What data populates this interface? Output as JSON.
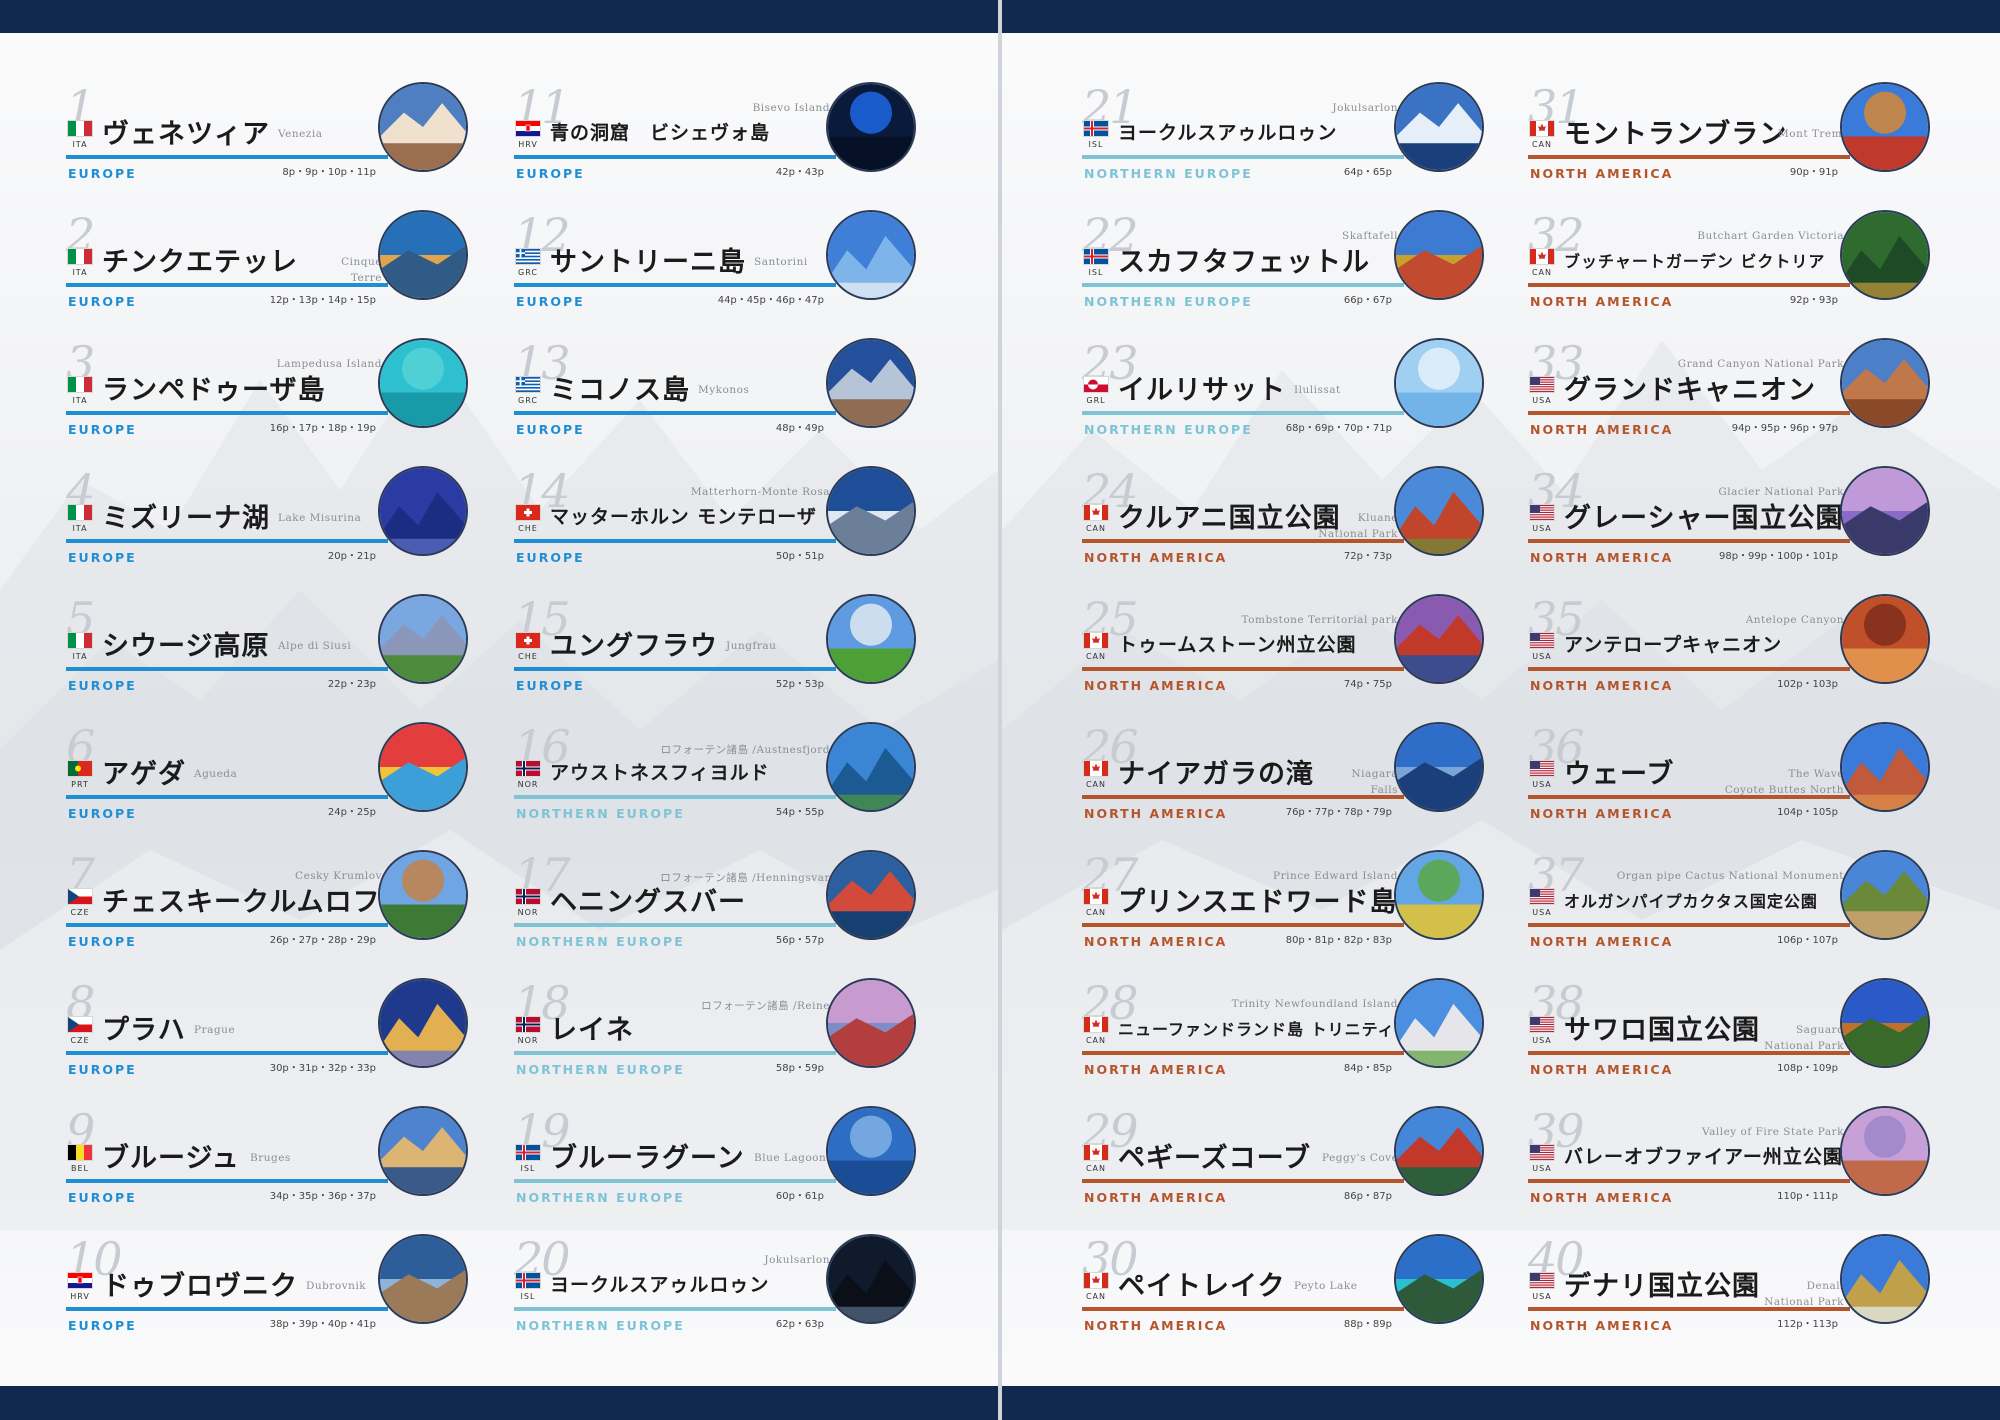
{
  "regions": {
    "europe": {
      "label": "EUROPE",
      "color": "#1f8fd1"
    },
    "northern_europe": {
      "label": "NORTHERN EUROPE",
      "color": "#7ec4d6"
    },
    "north_america": {
      "label": "NORTH AMERICA",
      "color": "#b4552c"
    }
  },
  "entries": [
    {
      "num": "1",
      "code": "ITA",
      "flag": "ita",
      "jp": "ヴェネツィア",
      "en": "Venezia",
      "pages": "8p・9p・10p・11p",
      "region": "EUROPE",
      "rkey": "europe",
      "photo": "venice-photo",
      "colors": [
        "#4f7fc1",
        "#f0e1cf",
        "#9a6e4e"
      ]
    },
    {
      "num": "2",
      "code": "ITA",
      "flag": "ita",
      "jp": "チンクエテッレ",
      "en": "Cinque\nTerre",
      "pages": "12p・13p・14p・15p",
      "region": "EUROPE",
      "rkey": "europe",
      "photo": "cinque-terre-photo",
      "colors": [
        "#2670b8",
        "#e2a34d",
        "#2f5b86"
      ]
    },
    {
      "num": "3",
      "code": "ITA",
      "flag": "ita",
      "jp": "ランペドゥーザ島",
      "en": "Lampedusa Island",
      "pages": "16p・17p・18p・19p",
      "region": "EUROPE",
      "rkey": "europe",
      "photo": "lampedusa-photo",
      "colors": [
        "#2fc0cf",
        "#58d3d5",
        "#199aa8"
      ]
    },
    {
      "num": "4",
      "code": "ITA",
      "flag": "ita",
      "jp": "ミズリーナ湖",
      "en": "Lake Misurina",
      "pages": "20p・21p",
      "region": "EUROPE",
      "rkey": "europe",
      "photo": "misurina-photo",
      "colors": [
        "#2b3ba4",
        "#6071c8",
        "#1b2d83"
      ]
    },
    {
      "num": "5",
      "code": "ITA",
      "flag": "ita",
      "jp": "シウージ高原",
      "en": "Alpe di Siusi",
      "pages": "22p・23p",
      "region": "EUROPE",
      "rkey": "europe",
      "photo": "alpe-di-siusi-photo",
      "colors": [
        "#7aa7e0",
        "#8a97b8",
        "#4d8b3c"
      ]
    },
    {
      "num": "6",
      "code": "PRT",
      "flag": "prt",
      "jp": "アゲダ",
      "en": "Agueda",
      "pages": "24p・25p",
      "region": "EUROPE",
      "rkey": "europe",
      "photo": "agueda-photo",
      "colors": [
        "#e43d3d",
        "#f2c23a",
        "#3c9fd8"
      ]
    },
    {
      "num": "7",
      "code": "CZE",
      "flag": "cze",
      "jp": "チェスキークルムロフ",
      "en": "Cesky Krumlov",
      "pages": "26p・27p・28p・29p",
      "region": "EUROPE",
      "rkey": "europe",
      "photo": "cesky-krumlov-photo",
      "colors": [
        "#6fa5e2",
        "#c9813e",
        "#3d7a35"
      ]
    },
    {
      "num": "8",
      "code": "CZE",
      "flag": "cze",
      "jp": "プラハ",
      "en": "Prague",
      "pages": "30p・31p・32p・33p",
      "region": "EUROPE",
      "rkey": "europe",
      "photo": "prague-photo",
      "colors": [
        "#1f3a8c",
        "#5c6fd6",
        "#e2b050"
      ]
    },
    {
      "num": "9",
      "code": "BEL",
      "flag": "bel",
      "jp": "ブルージュ",
      "en": "Bruges",
      "pages": "34p・35p・36p・37p",
      "region": "EUROPE",
      "rkey": "europe",
      "photo": "bruges-photo",
      "colors": [
        "#4d83cf",
        "#dcb474",
        "#3a5a8a"
      ]
    },
    {
      "num": "10",
      "code": "HRV",
      "flag": "hrv",
      "jp": "ドゥブロヴニク",
      "en": "Dubrovnik",
      "pages": "38p・39p・40p・41p",
      "region": "EUROPE",
      "rkey": "europe",
      "photo": "dubrovnik-photo",
      "colors": [
        "#2d5e9a",
        "#8fb2d6",
        "#9a7a58"
      ]
    },
    {
      "num": "11",
      "code": "HRV",
      "flag": "hrv",
      "jp": "青の洞窟　ビシェヴォ島",
      "en": "Bisevo Island",
      "pages": "42p・43p",
      "region": "EUROPE",
      "rkey": "europe",
      "photo": "bisevo-photo",
      "colors": [
        "#0a1a3a",
        "#1e6cf0",
        "#061128"
      ]
    },
    {
      "num": "12",
      "code": "GRC",
      "flag": "grc",
      "jp": "サントリーニ島",
      "en": "Santorini",
      "pages": "44p・45p・46p・47p",
      "region": "EUROPE",
      "rkey": "europe",
      "photo": "santorini-photo",
      "colors": [
        "#3f7fd8",
        "#f2f2f5",
        "#7db5ea"
      ]
    },
    {
      "num": "13",
      "code": "GRC",
      "flag": "grc",
      "jp": "ミコノス島",
      "en": "Mykonos",
      "pages": "48p・49p",
      "region": "EUROPE",
      "rkey": "europe",
      "photo": "mykonos-photo",
      "colors": [
        "#244f9a",
        "#b6c4d8",
        "#8f6d55"
      ]
    },
    {
      "num": "14",
      "code": "CHE",
      "flag": "che",
      "jp": "マッターホルン モンテローザ",
      "en": "Matterhorn-Monte Rosa",
      "pages": "50p・51p",
      "region": "EUROPE",
      "rkey": "europe",
      "photo": "matterhorn-photo",
      "colors": [
        "#1e4e98",
        "#dfe7f0",
        "#6c7f99"
      ]
    },
    {
      "num": "15",
      "code": "CHE",
      "flag": "che",
      "jp": "ユングフラウ",
      "en": "Jungfrau",
      "pages": "52p・53p",
      "region": "EUROPE",
      "rkey": "europe",
      "photo": "jungfrau-photo",
      "colors": [
        "#5e9be0",
        "#e6edf3",
        "#4ca036"
      ]
    },
    {
      "num": "16",
      "code": "NOR",
      "flag": "nor",
      "jp": "アウストネスフィヨルド",
      "en": "ロフォーテン諸島 /Austnesfjord",
      "pages": "54p・55p",
      "region": "NORTHERN EUROPE",
      "rkey": "northern_europe",
      "photo": "austnesfjord-photo",
      "colors": [
        "#3a86d4",
        "#4f9a3c",
        "#1c5a94"
      ]
    },
    {
      "num": "17",
      "code": "NOR",
      "flag": "nor",
      "jp": "ヘニングスバー",
      "en": "ロフォーテン諸島 /Henningsvar",
      "pages": "56p・57p",
      "region": "NORTHERN EUROPE",
      "rkey": "northern_europe",
      "photo": "henningsvaer-photo",
      "colors": [
        "#2b5fa0",
        "#d14a3a",
        "#183f72"
      ]
    },
    {
      "num": "18",
      "code": "NOR",
      "flag": "nor",
      "jp": "レイネ",
      "en": "ロフォーテン諸島 /Reine",
      "pages": "58p・59p",
      "region": "NORTHERN EUROPE",
      "rkey": "northern_europe",
      "photo": "reine-photo",
      "colors": [
        "#c79ad0",
        "#7f8cc8",
        "#b23e3e"
      ]
    },
    {
      "num": "19",
      "code": "ISL",
      "flag": "isl",
      "jp": "ブルーラグーン",
      "en": "Blue Lagoon",
      "pages": "60p・61p",
      "region": "NORTHERN EUROPE",
      "rkey": "northern_europe",
      "photo": "blue-lagoon-photo",
      "colors": [
        "#2e6dc4",
        "#86b4e6",
        "#1b4d96"
      ]
    },
    {
      "num": "20",
      "code": "ISL",
      "flag": "isl",
      "jp": "ヨークルスアゥルロゥン",
      "en": "Jokulsarlon",
      "pages": "62p・63p",
      "region": "NORTHERN EUROPE",
      "rkey": "northern_europe",
      "photo": "jokulsarlon-night-photo",
      "colors": [
        "#0f1a2c",
        "#5a6f8c",
        "#0a0f18"
      ]
    },
    {
      "num": "21",
      "code": "ISL",
      "flag": "isl",
      "jp": "ヨークルスアゥルロゥン",
      "en": "Jokulsarlon",
      "pages": "64p・65p",
      "region": "NORTHERN EUROPE",
      "rkey": "northern_europe",
      "photo": "jokulsarlon-photo",
      "colors": [
        "#3a73c4",
        "#e6eef7",
        "#1b3f7a"
      ]
    },
    {
      "num": "22",
      "code": "ISL",
      "flag": "isl",
      "jp": "スカフタフェットル",
      "en": "Skaftafell",
      "pages": "66p・67p",
      "region": "NORTHERN EUROPE",
      "rkey": "northern_europe",
      "photo": "skaftafell-photo",
      "colors": [
        "#3d7ad2",
        "#c8a02e",
        "#c24a2e"
      ]
    },
    {
      "num": "23",
      "code": "GRL",
      "flag": "grl",
      "jp": "イルリサット",
      "en": "Ilulissat",
      "pages": "68p・69p・70p・71p",
      "region": "NORTHERN EUROPE",
      "rkey": "northern_europe",
      "photo": "ilulissat-photo",
      "colors": [
        "#9fd0f2",
        "#e8f3fb",
        "#73b4e8"
      ]
    },
    {
      "num": "24",
      "code": "CAN",
      "flag": "can",
      "jp": "クルアニ国立公園",
      "en": "Kluane\nNational Park",
      "pages": "72p・73p",
      "region": "NORTH AMERICA",
      "rkey": "north_america",
      "photo": "kluane-photo",
      "colors": [
        "#4a8ad8",
        "#6b8f3a",
        "#c0452a"
      ]
    },
    {
      "num": "25",
      "code": "CAN",
      "flag": "can",
      "jp": "トゥームストーン州立公園",
      "en": "Tombstone Territorial park",
      "pages": "74p・75p",
      "region": "NORTH AMERICA",
      "rkey": "north_america",
      "photo": "tombstone-photo",
      "colors": [
        "#8a5ab0",
        "#c0392b",
        "#3c4c8c"
      ]
    },
    {
      "num": "26",
      "code": "CAN",
      "flag": "can",
      "jp": "ナイアガラの滝",
      "en": "Niagara\nFalls",
      "pages": "76p・77p・78p・79p",
      "region": "NORTH AMERICA",
      "rkey": "north_america",
      "photo": "niagara-photo",
      "colors": [
        "#2f6ec8",
        "#7aa6d6",
        "#1b3f7a"
      ]
    },
    {
      "num": "27",
      "code": "CAN",
      "flag": "can",
      "jp": "プリンスエドワード島",
      "en": "Prince Edward Island",
      "pages": "80p・81p・82p・83p",
      "region": "NORTH AMERICA",
      "rkey": "north_america",
      "photo": "prince-edward-photo",
      "colors": [
        "#62a6e6",
        "#5aa83a",
        "#d2c04a"
      ]
    },
    {
      "num": "28",
      "code": "CAN",
      "flag": "can",
      "jp": "ニューファンドランド島 トリニティ",
      "en": "Trinity Newfoundland Island",
      "pages": "84p・85p",
      "region": "NORTH AMERICA",
      "rkey": "north_america",
      "photo": "trinity-photo",
      "colors": [
        "#4b8fe0",
        "#5aa03a",
        "#e6e6ea"
      ]
    },
    {
      "num": "29",
      "code": "CAN",
      "flag": "can",
      "jp": "ペギーズコーブ",
      "en": "Peggy's Cove",
      "pages": "86p・87p",
      "region": "NORTH AMERICA",
      "rkey": "north_america",
      "photo": "peggys-cove-photo",
      "colors": [
        "#4486d8",
        "#c0392b",
        "#2d5f3a"
      ]
    },
    {
      "num": "30",
      "code": "CAN",
      "flag": "can",
      "jp": "ペイトレイク",
      "en": "Peyto Lake",
      "pages": "88p・89p",
      "region": "NORTH AMERICA",
      "rkey": "north_america",
      "photo": "peyto-lake-photo",
      "colors": [
        "#2b6fc8",
        "#2bc0d0",
        "#2f5a3a"
      ]
    },
    {
      "num": "31",
      "code": "CAN",
      "flag": "can",
      "jp": "モントランブラン",
      "en": "Mont Tremblant",
      "pages": "90p・91p",
      "region": "NORTH AMERICA",
      "rkey": "north_america",
      "photo": "mont-tremblant-photo",
      "colors": [
        "#3a7ad8",
        "#e08a2a",
        "#c0392b"
      ]
    },
    {
      "num": "32",
      "code": "CAN",
      "flag": "can",
      "jp": "ブッチャートガーデン ビクトリア",
      "en": "Butchart Garden Victoria",
      "pages": "92p・93p",
      "region": "NORTH AMERICA",
      "rkey": "north_america",
      "photo": "butchart-photo",
      "colors": [
        "#2f6a2f",
        "#c89a3a",
        "#1f4a26"
      ]
    },
    {
      "num": "33",
      "code": "USA",
      "flag": "usa",
      "jp": "グランドキャニオン",
      "en": "Grand Canyon National Park",
      "pages": "94p・95p・96p・97p",
      "region": "NORTH AMERICA",
      "rkey": "north_america",
      "photo": "grand-canyon-photo",
      "colors": [
        "#4b7fc8",
        "#c0784a",
        "#8a4a2a"
      ]
    },
    {
      "num": "34",
      "code": "USA",
      "flag": "usa",
      "jp": "グレーシャー国立公園",
      "en": "Glacier National Park",
      "pages": "98p・99p・100p・101p",
      "region": "NORTH AMERICA",
      "rkey": "north_america",
      "photo": "glacier-photo",
      "colors": [
        "#c09ad8",
        "#8a6ac8",
        "#3a3a6a"
      ]
    },
    {
      "num": "35",
      "code": "USA",
      "flag": "usa",
      "jp": "アンテロープキャニオン",
      "en": "Antelope Canyon",
      "pages": "102p・103p",
      "region": "NORTH AMERICA",
      "rkey": "north_america",
      "photo": "antelope-photo",
      "colors": [
        "#c0502a",
        "#7a2a1a",
        "#e0904a"
      ]
    },
    {
      "num": "36",
      "code": "USA",
      "flag": "usa",
      "jp": "ウェーブ",
      "en": "The Wave\nCoyote Buttes North",
      "pages": "104p・105p",
      "region": "NORTH AMERICA",
      "rkey": "north_america",
      "photo": "the-wave-photo",
      "colors": [
        "#3a7ad8",
        "#e0904a",
        "#c05a3a"
      ]
    },
    {
      "num": "37",
      "code": "USA",
      "flag": "usa",
      "jp": "オルガンパイプカクタス国定公園",
      "en": "Organ pipe Cactus National Monument",
      "pages": "106p・107p",
      "region": "NORTH AMERICA",
      "rkey": "north_america",
      "photo": "organ-pipe-photo",
      "colors": [
        "#4a86d8",
        "#6a8a3a",
        "#c0a06a"
      ]
    },
    {
      "num": "38",
      "code": "USA",
      "flag": "usa",
      "jp": "サワロ国立公園",
      "en": "Saguaro\nNational Park",
      "pages": "108p・109p",
      "region": "NORTH AMERICA",
      "rkey": "north_america",
      "photo": "saguaro-photo",
      "colors": [
        "#2a5ac8",
        "#c0702a",
        "#3a6a2a"
      ]
    },
    {
      "num": "39",
      "code": "USA",
      "flag": "usa",
      "jp": "バレーオブファイアー州立公園",
      "en": "Valley of Fire State Park",
      "pages": "110p・111p",
      "region": "NORTH AMERICA",
      "rkey": "north_america",
      "photo": "valley-of-fire-photo",
      "colors": [
        "#c8a0d8",
        "#9a86c8",
        "#c06a4a"
      ]
    },
    {
      "num": "40",
      "code": "USA",
      "flag": "usa",
      "jp": "デナリ国立公園",
      "en": "Denali\nNational Park",
      "pages": "112p・113p",
      "region": "NORTH AMERICA",
      "rkey": "north_america",
      "photo": "denali-photo",
      "colors": [
        "#3a7ad8",
        "#e6eef7",
        "#c0a04a"
      ]
    }
  ]
}
